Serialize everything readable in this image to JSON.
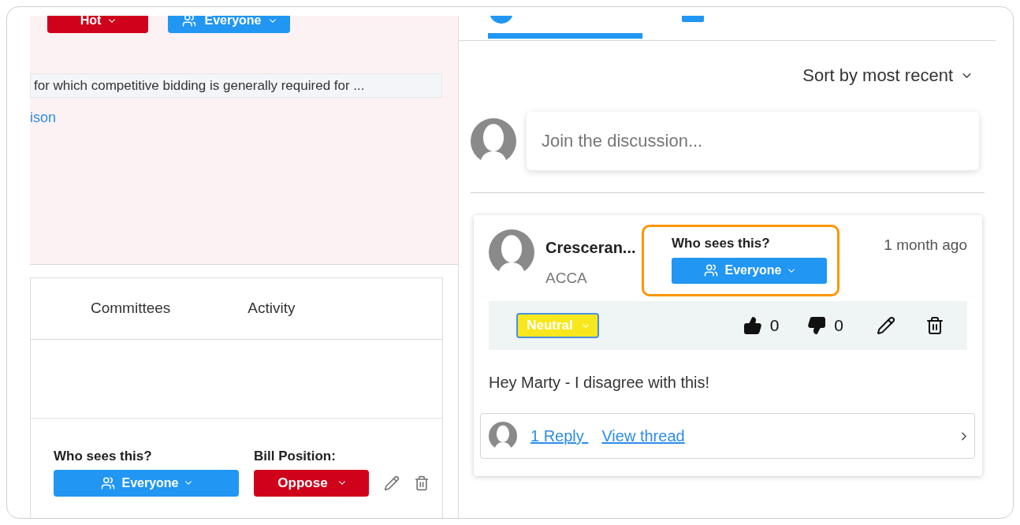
{
  "left_panel": {
    "header_buttons": [
      {
        "label": "Hot",
        "kind": "priority"
      },
      {
        "label": "Everyone",
        "kind": "audience"
      }
    ],
    "summary_field": {
      "value": "for which competitive bidding is generally required for ..."
    },
    "link": "ison",
    "tabs": [
      {
        "label": "Committees",
        "selected": false
      },
      {
        "label": "Activity",
        "selected": false
      }
    ],
    "note_controls": {
      "visibility_label": "Who sees this?",
      "visibility": "Everyone",
      "position_label": "Bill Position:",
      "position": "Oppose"
    }
  },
  "right_panel": {
    "tabs": [
      {
        "selected": true,
        "kind": "discussion"
      },
      {
        "selected": false,
        "kind": "list"
      }
    ],
    "sort": "Sort by most recent",
    "comment_input": {
      "placeholder": "Join the discussion..."
    },
    "comments": [
      {
        "author": "Cresceran...",
        "organization": "ACCA",
        "visibility_label": "Who sees this?",
        "visibility": "Everyone",
        "highlighted": true,
        "time": "1 month ago",
        "stance": "Neutral",
        "likes": "0",
        "dislikes": "0",
        "text": "Hey Marty - I disagree with this!",
        "replies": "1 Reply ",
        "view_thread": "View thread"
      }
    ]
  }
}
